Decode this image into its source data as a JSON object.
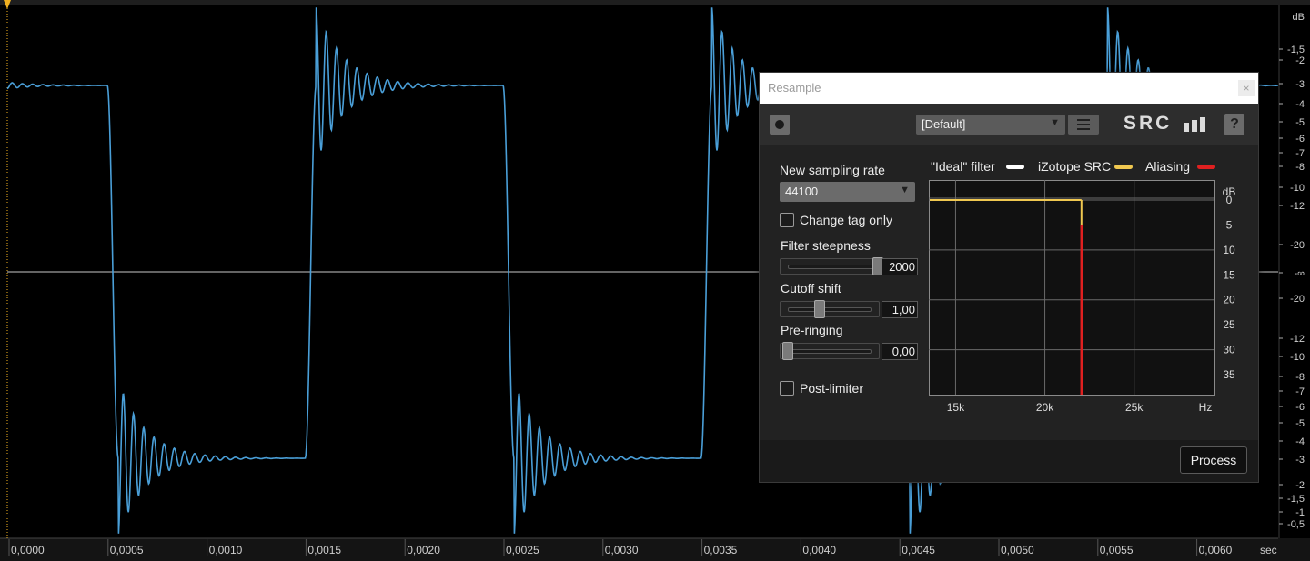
{
  "waveform": {
    "db_scale_labels": [
      "dB",
      "-1,5",
      "-2",
      "-3",
      "-4",
      "-5",
      "-6",
      "-7",
      "-8",
      "-10",
      "-12",
      "-20",
      "-∞",
      "-20",
      "-12",
      "-10",
      "-8",
      "-7",
      "-6",
      "-5",
      "-4",
      "-3",
      "-2",
      "-1,5",
      "-1",
      "-0,5"
    ],
    "time_labels": [
      "0,0000",
      "0,0005",
      "0,0010",
      "0,0015",
      "0,0020",
      "0,0025",
      "0,0030",
      "0,0035",
      "0,0040",
      "0,0045",
      "0,0050",
      "0,0055",
      "0,0060"
    ],
    "time_unit": "sec",
    "colors": {
      "wave": "#4a9fd8",
      "center_line": "#c8c8c8",
      "playhead": "#f0b020"
    }
  },
  "dialog": {
    "title": "Resample",
    "close_icon": "×",
    "preset": "[Default]",
    "logo": "SRC",
    "help_label": "?",
    "new_sampling_rate_label": "New sampling rate",
    "sampling_rate_value": "44100",
    "change_tag_only_label": "Change tag only",
    "filter_steepness_label": "Filter steepness",
    "filter_steepness_value": "2000",
    "filter_steepness_fraction": 0.97,
    "cutoff_shift_label": "Cutoff shift",
    "cutoff_shift_value": "1,00",
    "cutoff_shift_fraction": 0.4,
    "pre_ringing_label": "Pre-ringing",
    "pre_ringing_value": "0,00",
    "pre_ringing_fraction": 0.0,
    "post_limiter_label": "Post-limiter",
    "process_label": "Process",
    "legend": {
      "ideal": "\"Ideal\" filter",
      "izotope": "iZotope SRC",
      "aliasing": "Aliasing",
      "colors": {
        "ideal": "#ffffff",
        "izotope": "#f0c850",
        "aliasing": "#e02020"
      }
    },
    "graph": {
      "db_unit": "dB",
      "db_ticks": [
        "0",
        "5",
        "10",
        "15",
        "20",
        "25",
        "30",
        "35"
      ],
      "freq_ticks": [
        "15k",
        "20k",
        "25k"
      ],
      "freq_unit": "Hz",
      "freq_range": [
        13500,
        29500
      ],
      "db_range": [
        -4,
        39
      ],
      "passband_db": 0,
      "cutoff_hz": 22050,
      "izotope_drop_db": 5,
      "aliasing_from_db": 5
    }
  }
}
